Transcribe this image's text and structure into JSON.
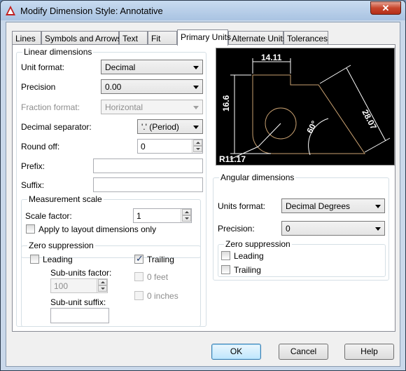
{
  "window": {
    "title": "Modify Dimension Style: Annotative",
    "close": "✕"
  },
  "tabs": [
    "Lines",
    "Symbols and Arrows",
    "Text",
    "Fit",
    "Primary Units",
    "Alternate Units",
    "Tolerances"
  ],
  "linear": {
    "group_label": "Linear dimensions",
    "unit_format_label": "Unit format:",
    "unit_format_value": "Decimal",
    "precision_label": "Precision",
    "precision_value": "0.00",
    "fraction_label": "Fraction format:",
    "fraction_value": "Horizontal",
    "decimal_sep_label": "Decimal separator:",
    "decimal_sep_value": "'.' (Period)",
    "round_off_label": "Round off:",
    "round_off_value": "0",
    "prefix_label": "Prefix:",
    "prefix_value": "",
    "suffix_label": "Suffix:",
    "suffix_value": ""
  },
  "measurement": {
    "group_label": "Measurement scale",
    "scale_label": "Scale factor:",
    "scale_value": "1",
    "apply_layout_label": "Apply to layout dimensions only"
  },
  "zero_linear": {
    "group_label": "Zero suppression",
    "leading": "Leading",
    "trailing": "Trailing",
    "subunits_factor_label": "Sub-units factor:",
    "subunits_factor_value": "100",
    "subunit_suffix_label": "Sub-unit suffix:",
    "subunit_suffix_value": "",
    "feet": "0 feet",
    "inches": "0 inches"
  },
  "angular": {
    "group_label": "Angular dimensions",
    "units_format_label": "Units format:",
    "units_format_value": "Decimal Degrees",
    "precision_label": "Precision:",
    "precision_value": "0",
    "zero_label": "Zero suppression",
    "leading": "Leading",
    "trailing": "Trailing"
  },
  "preview": {
    "dim_top": "14.11",
    "dim_left": "16.6",
    "dim_right": "28.07",
    "angle": "60°",
    "radius": "R11.17"
  },
  "buttons": {
    "ok": "OK",
    "cancel": "Cancel",
    "help": "Help"
  },
  "colors": {
    "accent": "#3c7fb1",
    "preview_lines": "#c8a070",
    "close": "#c7452c"
  }
}
